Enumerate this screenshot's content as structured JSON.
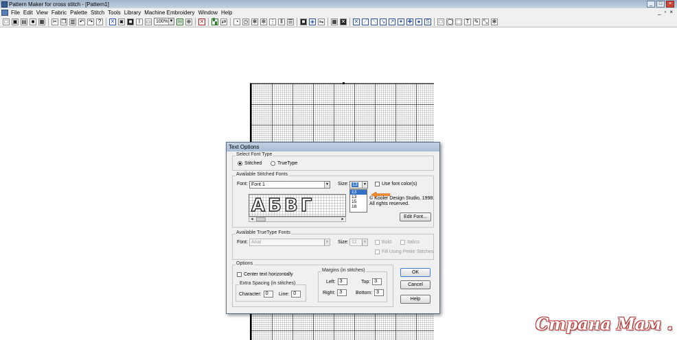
{
  "window": {
    "title": "Pattern Maker for cross stitch - [Pattern1]"
  },
  "menu": [
    "File",
    "Edit",
    "View",
    "Fabric",
    "Palette",
    "Stitch",
    "Tools",
    "Library",
    "Machine Embroidery",
    "Window",
    "Help"
  ],
  "toolbar": {
    "zoom_value": "100%"
  },
  "dialog": {
    "title": "Text Options",
    "font_type": {
      "label": "Select Font Type",
      "stitched": "Stitched",
      "truetype": "TrueType",
      "selected": "Stitched"
    },
    "stitched_fonts": {
      "label": "Available Stitched Fonts",
      "font_label": "Font:",
      "font_value": "Font 1",
      "size_label": "Size:",
      "size_value": "13",
      "size_options": [
        "13",
        "13",
        "15",
        "18"
      ],
      "use_font_colors": "Use font color(s)",
      "preview_letters": [
        "А",
        "Б",
        "В",
        "Г"
      ],
      "copyright": "© Kooler Design Studio, 1998.",
      "rights": "All rights reserved.",
      "edit_font": "Edit Font..."
    },
    "truetype_fonts": {
      "label": "Available TrueType Fonts",
      "font_label": "Font:",
      "font_value": "Arial",
      "size_label": "Size:",
      "size_value": "12",
      "bold": "Bold",
      "italics": "Italics",
      "fill_petite": "Fill Using Petite Stitches"
    },
    "options": {
      "label": "Options",
      "center_text": "Center text horizontally",
      "extra_spacing": {
        "label": "Extra Spacing (in stitches)",
        "character_label": "Character:",
        "character_value": "0",
        "line_label": "Line:",
        "line_value": "0"
      },
      "margins": {
        "label": "Margins (in stitches)",
        "left_label": "Left:",
        "left_value": "3",
        "top_label": "Top:",
        "top_value": "3",
        "right_label": "Right:",
        "right_value": "3",
        "bottom_label": "Bottom:",
        "bottom_value": "3"
      }
    },
    "buttons": {
      "ok": "OK",
      "cancel": "Cancel",
      "help": "Help"
    }
  },
  "watermark": "Страна Мам . ру"
}
